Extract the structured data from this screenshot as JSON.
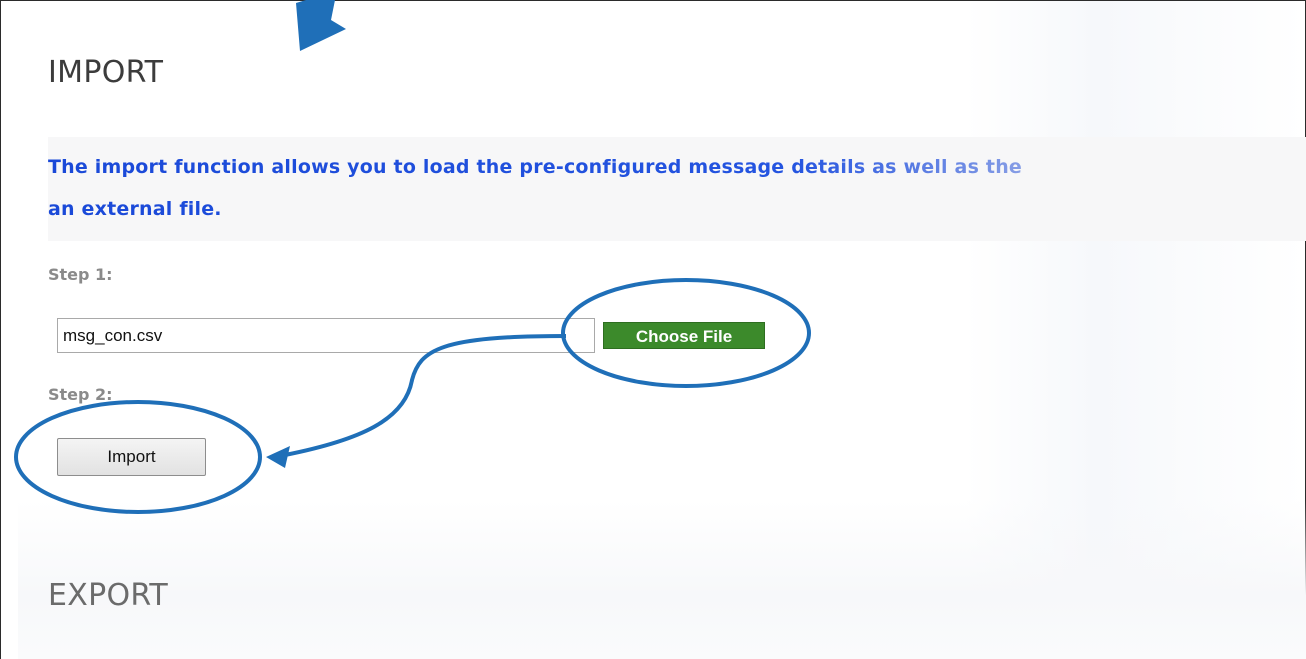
{
  "import_section": {
    "title": "IMPORT",
    "description_line1": "The import function allows you to load the pre-configured message details as well as the",
    "description_line2": "an external file.",
    "step1_label": "Step 1:",
    "file_value": "msg_con.csv",
    "choose_file_label": "Choose File",
    "step2_label": "Step 2:",
    "import_button_label": "Import"
  },
  "export_section": {
    "title": "EXPORT"
  },
  "annotations": {
    "color": "#1f6fb8",
    "icons": [
      "down-arrow-annotation-icon",
      "choose-file-highlight-icon",
      "import-highlight-icon",
      "connector-arrow-icon"
    ]
  }
}
